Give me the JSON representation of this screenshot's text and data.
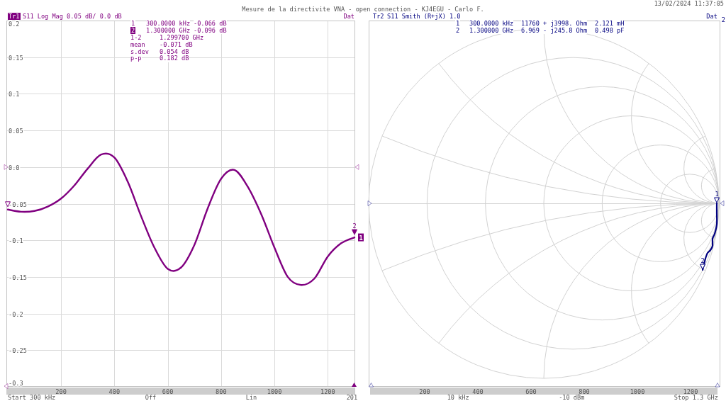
{
  "window": {
    "title": "Mesure de la directivite VNA - open connection - KJ4EGU - Carlo F.",
    "timestamp": "13/02/2024 11:37:05"
  },
  "traces": [
    {
      "kind": "log_mag",
      "badge": "Tr1",
      "selected": true,
      "color": "#800080",
      "label": "S11 Log Mag 0.05 dB/ 0.0 dB",
      "status": "Dat",
      "markers": [
        {
          "number": "1",
          "frequency": "300.0000 kHz",
          "reading": "-0.066 dB",
          "selected": false
        },
        {
          "number": "2",
          "frequency": "1.300000 GHz",
          "reading": "-0.096 dB",
          "selected": true,
          "flag": "2"
        }
      ],
      "statistics": [
        {
          "label": "1-2",
          "value": "1.299700 GHz"
        },
        {
          "label": "mean",
          "value": "-0.071 dB"
        },
        {
          "label": "s.dev",
          "value": "0.054 dB"
        },
        {
          "label": "p-p",
          "value": "0.182 dB"
        }
      ],
      "end_label": "1",
      "chart_data": {
        "type": "line",
        "x": [
          0.3,
          50,
          100,
          150,
          200,
          250,
          300,
          350,
          400,
          450,
          500,
          550,
          600,
          650,
          700,
          750,
          800,
          850,
          900,
          950,
          1000,
          1050,
          1100,
          1150,
          1200,
          1250,
          1300
        ],
        "values": [
          -0.058,
          -0.061,
          -0.06,
          -0.054,
          -0.043,
          -0.025,
          -0.002,
          0.017,
          0.013,
          -0.02,
          -0.067,
          -0.11,
          -0.139,
          -0.137,
          -0.106,
          -0.056,
          -0.016,
          -0.004,
          -0.027,
          -0.064,
          -0.11,
          -0.15,
          -0.161,
          -0.152,
          -0.122,
          -0.104,
          -0.096
        ],
        "xlim": [
          0.3,
          1300
        ],
        "ylim": [
          -0.3,
          0.2
        ],
        "xticks": [
          200,
          400,
          600,
          800,
          1000,
          1200
        ],
        "yticks": [
          0.2,
          0.15,
          0.1,
          0.05,
          {
            "value": 0,
            "label": "0.0"
          },
          -0.05,
          -0.1,
          -0.15,
          -0.2,
          -0.25,
          -0.3
        ],
        "grid": true
      }
    },
    {
      "kind": "smith",
      "badge": "Tr2",
      "selected": false,
      "color": "#000080",
      "label": "S11 Smith (R+jX) 1.0",
      "status": "Dat",
      "corner_label": "2",
      "markers": [
        {
          "number": "1",
          "frequency": "300.0000 kHz",
          "reading": "11760 + j3998. Ohm",
          "equivalent": "2.121 mH",
          "selected": false,
          "flag": "1"
        },
        {
          "number": "2",
          "frequency": "1.300000 GHz",
          "reading": "6.969 - j245.8 Ohm",
          "equivalent": "0.498 pF",
          "selected": false,
          "flag": "2"
        }
      ],
      "axis_labels": [
        "200",
        "400",
        "600",
        "800",
        "1000",
        "1200"
      ]
    }
  ],
  "status_bar": [
    "Start 300 kHz",
    "Off",
    "Lin",
    "201",
    "10 kHz",
    "-10 dBm",
    "Stop 1.3 GHz"
  ]
}
